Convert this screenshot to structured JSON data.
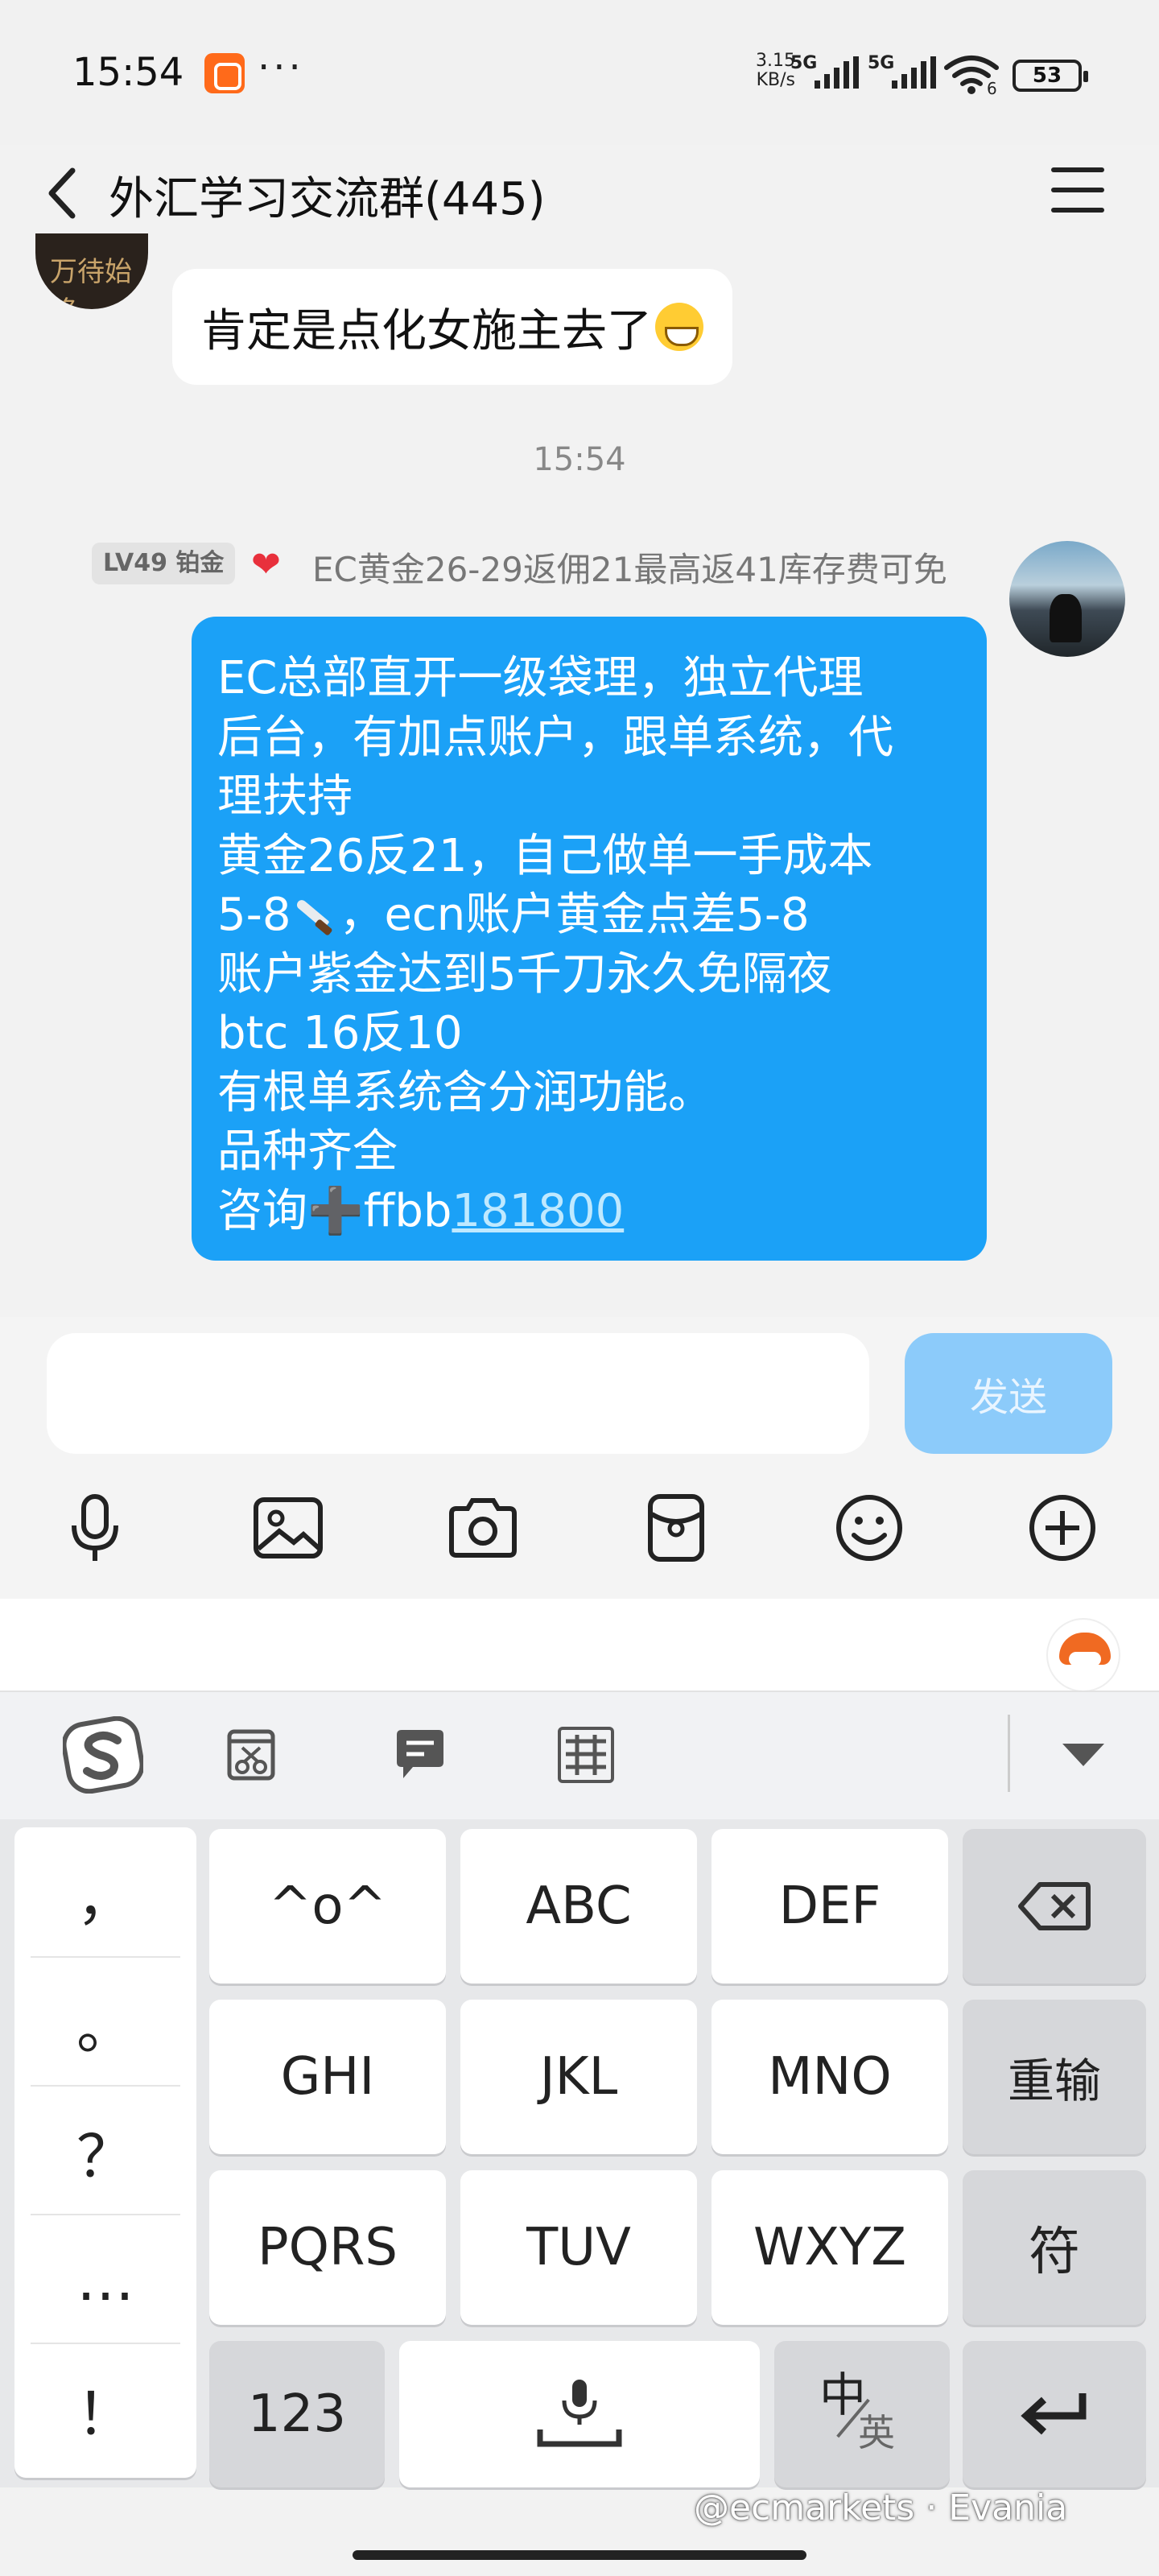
{
  "status_bar": {
    "time": "15:54",
    "more": "···",
    "net_speed_value": "3.15",
    "net_speed_unit": "KB/s",
    "signal_1_label": "5G",
    "signal_2_label": "5G",
    "wifi_label": "6",
    "battery": "53"
  },
  "header": {
    "title": "外汇学习交流群(445)"
  },
  "messages": [
    {
      "text": "肯定是点化女施主去了",
      "emoji": "grinning-face-icon"
    },
    {
      "timestamp": "15:54",
      "level": "LV49 铂金",
      "sender": "EC黄金26-29返佣21最高返41库存费可免",
      "lines": [
        "EC总部直开一级袋理，独立代理",
        "后台，有加点账户，跟单系统，代",
        "理扶持",
        "黄金26反21，自己做单一手成本",
        "5-8",
        "，ecn账户黄金点差5-8",
        "账户紫金达到5千刀永久免隔夜",
        "btc 16反10",
        "有根单系统含分润功能。",
        "品种齐全",
        "咨询",
        "➕",
        "ffbb",
        "181800"
      ]
    }
  ],
  "input": {
    "placeholder": "",
    "send_label": "发送"
  },
  "toolbar_icons": [
    "microphone-icon",
    "image-icon",
    "camera-icon",
    "red-packet-icon",
    "emoji-icon",
    "plus-icon"
  ],
  "keyboard": {
    "punctuation": [
      "，",
      "。",
      "？",
      "…",
      "！"
    ],
    "rows": [
      [
        "^o^",
        "ABC",
        "DEF"
      ],
      [
        "GHI",
        "JKL",
        "MNO"
      ],
      [
        "PQRS",
        "TUV",
        "WXYZ"
      ]
    ],
    "reinput": "重输",
    "symbol": "符",
    "num": "123",
    "lang_main": "中",
    "lang_sub": "英"
  },
  "watermark": "@ecmarkets · Evania",
  "colors": {
    "accent_blue": "#1ba1f7",
    "send_disabled": "#8ccbfa",
    "sogou_orange": "#f06a22"
  }
}
